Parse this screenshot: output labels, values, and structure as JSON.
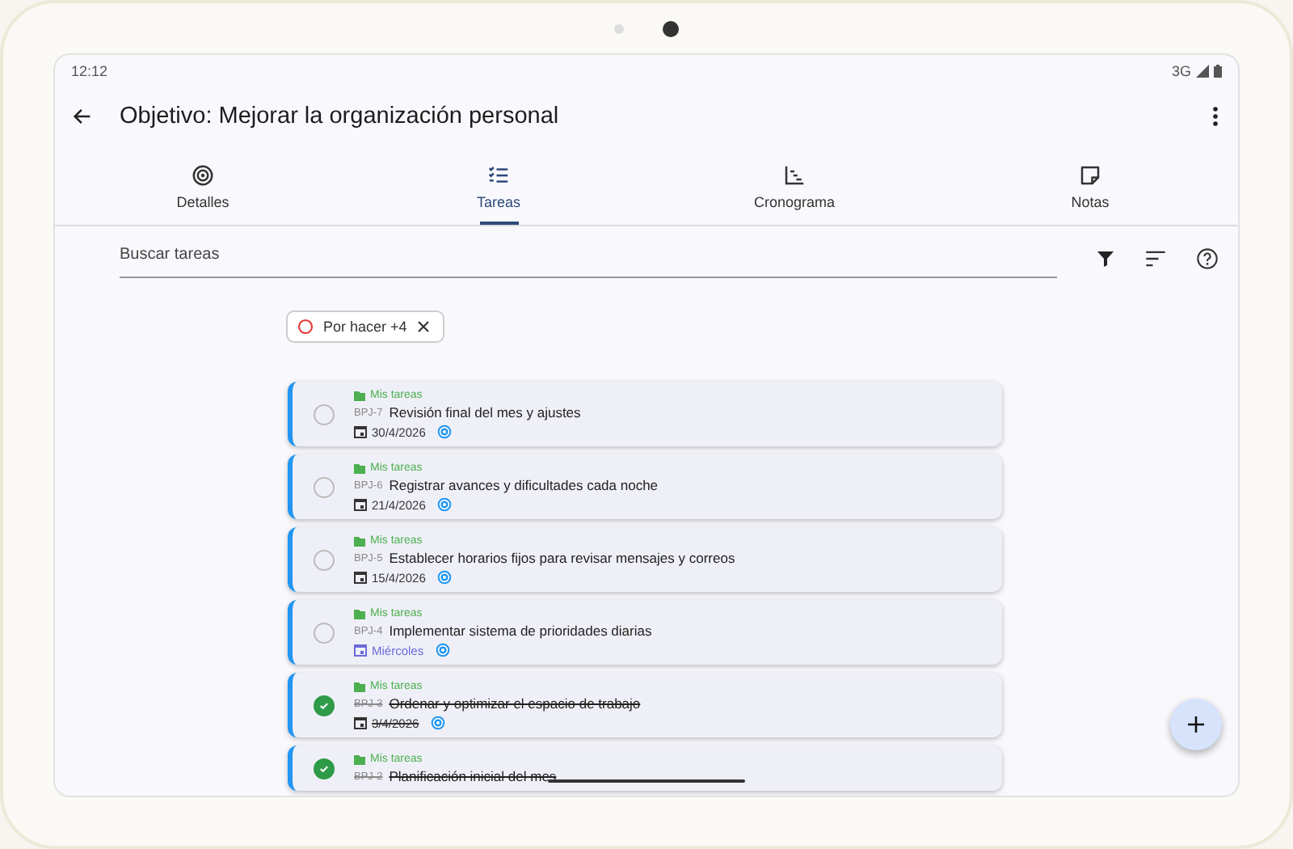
{
  "status_bar": {
    "time": "12:12",
    "network": "3G"
  },
  "app_bar": {
    "title": "Objetivo: Mejorar la organización personal"
  },
  "tabs": [
    {
      "label": "Detalles",
      "selected": false
    },
    {
      "label": "Tareas",
      "selected": true
    },
    {
      "label": "Cronograma",
      "selected": false
    },
    {
      "label": "Notas",
      "selected": false
    }
  ],
  "search": {
    "placeholder": "Buscar tareas"
  },
  "filter_chip": {
    "label": "Por hacer +4"
  },
  "tasks": [
    {
      "project": "Mis tareas",
      "id": "BPJ-7",
      "title": "Revisión final del mes y ajustes",
      "date": "30/4/2026",
      "date_highlighted": false,
      "done": false
    },
    {
      "project": "Mis tareas",
      "id": "BPJ-6",
      "title": "Registrar avances y dificultades cada noche",
      "date": "21/4/2026",
      "date_highlighted": false,
      "done": false
    },
    {
      "project": "Mis tareas",
      "id": "BPJ-5",
      "title": "Establecer horarios fijos para revisar mensajes y correos",
      "date": "15/4/2026",
      "date_highlighted": false,
      "done": false
    },
    {
      "project": "Mis tareas",
      "id": "BPJ-4",
      "title": "Implementar sistema de prioridades diarias",
      "date": "Miércoles",
      "date_highlighted": true,
      "done": false
    },
    {
      "project": "Mis tareas",
      "id": "BPJ-3",
      "title": "Ordenar y optimizar el espacio de trabajo",
      "date": "3/4/2026",
      "date_highlighted": false,
      "done": true
    },
    {
      "project": "Mis tareas",
      "id": "BPJ-2",
      "title": "Planificación inicial del mes",
      "done": true
    }
  ]
}
